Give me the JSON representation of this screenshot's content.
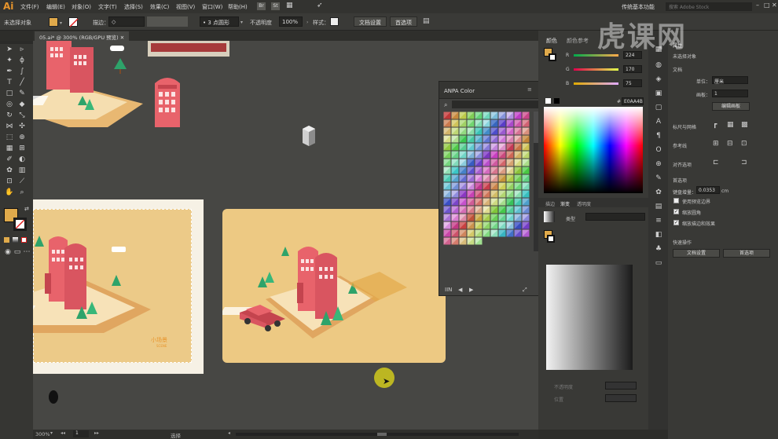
{
  "app": {
    "logo": "Ai"
  },
  "menu": {
    "items": [
      "文件(F)",
      "编辑(E)",
      "对象(O)",
      "文字(T)",
      "选择(S)",
      "效果(C)",
      "视图(V)",
      "窗口(W)",
      "帮助(H)"
    ],
    "workspace": "传统基本功能",
    "search_placeholder": "搜索 Adobe Stock"
  },
  "control": {
    "selection": "未选择对象",
    "stroke_label": "描边：",
    "stroke_value": "◇",
    "point_value": "• 3 点圆形",
    "opacity_label": "不透明度",
    "opacity_value": "100%",
    "style_label": "样式：",
    "doc_settings": "文档设置",
    "preferences": "首选项"
  },
  "document": {
    "tab": "05.ai* @ 300% (RGB/GPU 预览)",
    "zoom": "300%",
    "artboard": "1",
    "tool": "选择"
  },
  "artwork": {
    "card_title": "小场景",
    "card_subtitle": "SCENE"
  },
  "anpa": {
    "title": "ANPA Color",
    "search_icon": "search-icon"
  },
  "color_panel": {
    "tab_color": "颜色",
    "tab_ref": "颜色参考",
    "r_label": "R",
    "r_value": "224",
    "g_label": "G",
    "g_value": "170",
    "b_label": "B",
    "b_value": "75",
    "hex": "E0AA4B",
    "grad_tabs": [
      "描边",
      "渐变",
      "透明度"
    ],
    "type_label": "类型",
    "opacity_label": "不透明度",
    "position_label": "位置"
  },
  "props": {
    "title": "属性",
    "no_selection": "未选择对象",
    "doc_section": "文档",
    "unit_label": "单位：",
    "unit_value": "厘米",
    "artboard_label": "画板：",
    "artboard_value": "1",
    "edit_artboards": "编辑画板",
    "ruler_grid": "标尺与网格",
    "guides": "参考线",
    "align": "对齐选项",
    "prefs": "首选项",
    "nudge_label": "键盘增量：",
    "nudge_value": "0.0353",
    "nudge_unit": "cm",
    "opt1": "使用预览边界",
    "opt2": "缩放圆角",
    "opt3": "缩放描边和效果",
    "quick_actions": "快速操作",
    "doc_settings": "文档设置",
    "prefs_btn": "首选项"
  },
  "colors": {
    "fill": "#e0aa4b",
    "accent": "#e8952c",
    "card_bg": "#edc983",
    "pink": "#e8636b",
    "canvas": "#474744"
  },
  "watermark": "虎课网"
}
